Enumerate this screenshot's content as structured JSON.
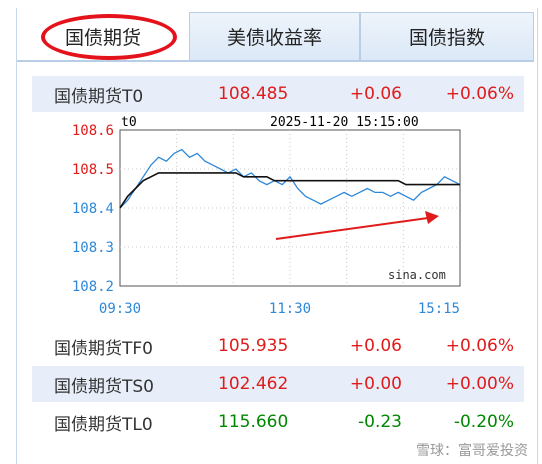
{
  "tabs": [
    {
      "label": "国债期货",
      "active": true
    },
    {
      "label": "美债收益率",
      "active": false
    },
    {
      "label": "国债指数",
      "active": false
    }
  ],
  "quotes": [
    {
      "name": "国债期货T0",
      "price": "108.485",
      "change": "+0.06",
      "pct": "+0.06%",
      "direction": "up"
    },
    {
      "name": "国债期货TF0",
      "price": "105.935",
      "change": "+0.06",
      "pct": "+0.06%",
      "direction": "up"
    },
    {
      "name": "国债期货TS0",
      "price": "102.462",
      "change": "+0.00",
      "pct": "+0.00%",
      "direction": "up"
    },
    {
      "name": "国债期货TL0",
      "price": "115.660",
      "change": "-0.23",
      "pct": "-0.20%",
      "direction": "down"
    }
  ],
  "colors": {
    "up": "#e01b1b",
    "down": "#008800",
    "tab_active_circle": "#e3121b",
    "price_line": "#2e88d8",
    "avg_line": "#111111"
  },
  "chart_data": {
    "type": "line",
    "symbol": "t0",
    "datetime": "2025-11-20 15:15:00",
    "watermark": "sina.com",
    "ylim": [
      108.2,
      108.6
    ],
    "yticks": [
      "108.6",
      "108.5",
      "108.4",
      "108.3",
      "108.2"
    ],
    "xticks": [
      "09:30",
      "11:30",
      "15:15"
    ],
    "grid": true,
    "series": [
      {
        "values": [
          108.4,
          108.42,
          108.45,
          108.48,
          108.51,
          108.53,
          108.52,
          108.54,
          108.55,
          108.53,
          108.54,
          108.52,
          108.51,
          108.5,
          108.49,
          108.5,
          108.48,
          108.49,
          108.47,
          108.46,
          108.47,
          108.46,
          108.48,
          108.45,
          108.43,
          108.42,
          108.41,
          108.42,
          108.43,
          108.44,
          108.43,
          108.44,
          108.45,
          108.44,
          108.44,
          108.43,
          108.44,
          108.43,
          108.42,
          108.44,
          108.45,
          108.46,
          108.48,
          108.47,
          108.46
        ]
      },
      {
        "values": [
          108.4,
          108.43,
          108.45,
          108.47,
          108.48,
          108.49,
          108.49,
          108.49,
          108.49,
          108.49,
          108.49,
          108.49,
          108.49,
          108.49,
          108.49,
          108.49,
          108.48,
          108.48,
          108.48,
          108.48,
          108.47,
          108.47,
          108.47,
          108.47,
          108.47,
          108.47,
          108.47,
          108.47,
          108.47,
          108.47,
          108.47,
          108.47,
          108.47,
          108.47,
          108.47,
          108.47,
          108.47,
          108.46,
          108.46,
          108.46,
          108.46,
          108.46,
          108.46,
          108.46,
          108.46
        ]
      }
    ]
  },
  "footer_watermark": "雪球：富哥爱投资"
}
